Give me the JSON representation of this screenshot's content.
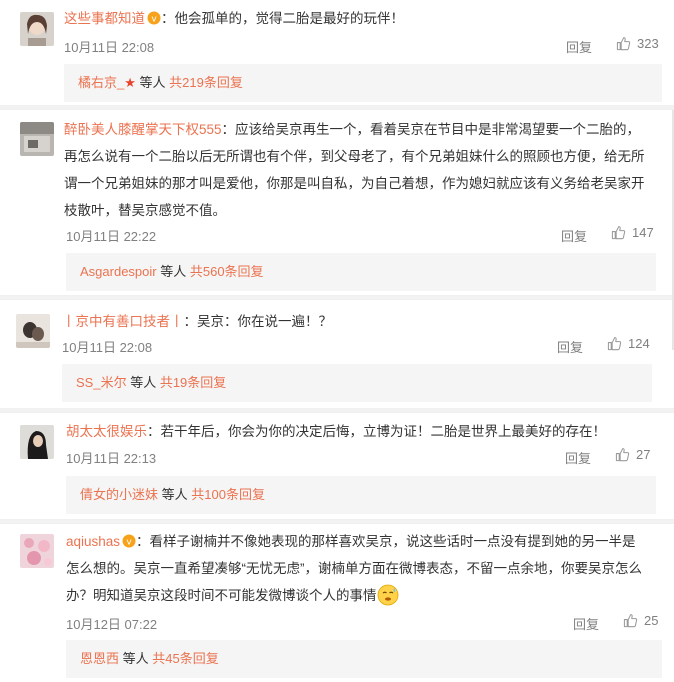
{
  "comments": [
    {
      "username": "这些事都知道",
      "text": "：他会孤单的，觉得二胎是最好的玩伴！",
      "date": "10月11日 22:08",
      "reply": "回复",
      "likes": "323",
      "sub_user": "橘右京_",
      "sub_etc": " 等人",
      "sub_count": "共219条回复"
    },
    {
      "username": "醉卧美人膝醒掌天下权555",
      "text_lines": [
        "：应该给吴京再生一个，看着吴京在节目中是非常渴望要一个二胎的，",
        "再怎么说有一个二胎以后无所谓也有个伴，到父母老了，有个兄弟姐妹什么的照顾也方便，给无所",
        "谓一个兄弟姐妹的那才叫是爱他，你那是叫自私，为自己着想，作为媳妇就应该有义务给老吴家开",
        "枝散叶，替吴京感觉不值。"
      ],
      "date": "10月11日 22:22",
      "reply": "回复",
      "likes": "147",
      "sub_user": "Asgardespoir",
      "sub_etc": " 等人",
      "sub_count": "共560条回复"
    },
    {
      "username": "丨京中有善口技者丨",
      "text": "：吴京：你在说一遍！？",
      "date": "10月11日 22:08",
      "reply": "回复",
      "likes": "124",
      "sub_user": "SS_米尔",
      "sub_etc": " 等人",
      "sub_count": "共19条回复"
    },
    {
      "username": "胡太太很娱乐",
      "text": "：若干年后，你会为你的决定后悔，立博为证！二胎是世界上最美好的存在！",
      "date": "10月11日 22:13",
      "reply": "回复",
      "likes": "27",
      "sub_user": "倩女的小迷妹",
      "sub_etc": " 等人",
      "sub_count": "共100条回复"
    },
    {
      "username": "aqiushas",
      "text_lines": [
        "：看样子谢楠并不像她表现的那样喜欢吴京，说这些话时一点没有提到她的另一半是",
        "怎么想的。吴京一直希望凑够“无忧无虑”，谢楠单方面在微博表态，不留一点余地，你要吴京怎么",
        "办？明知道吴京这段时间不可能发微博谈个人的事情"
      ],
      "date": "10月12日 07:22",
      "reply": "回复",
      "likes": "25",
      "sub_user": "恩恩西",
      "sub_etc": " 等人",
      "sub_count": "共45条回复"
    }
  ],
  "icons": {
    "like": "thumbs-up-icon",
    "vip_badge": "vip-badge-icon",
    "star": "red-star-icon",
    "emoji": "sweat-emoji-icon"
  },
  "colors": {
    "username": "#eb7350",
    "meta": "#808080",
    "sub_bg": "#f5f5f5",
    "page_bg": "#f2f2f2"
  }
}
